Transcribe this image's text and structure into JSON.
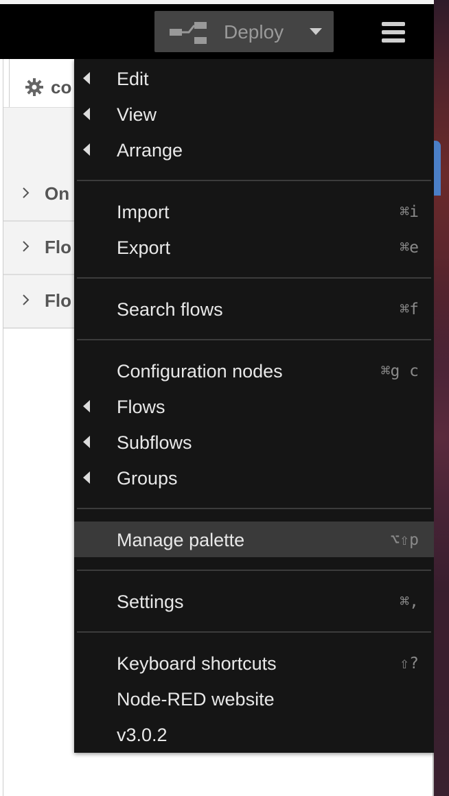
{
  "header": {
    "deploy_label": "Deploy",
    "deploy_icon": "deploy-icon",
    "menu_icon": "hamburger-menu-icon"
  },
  "sidebar": {
    "tab_label": "co",
    "tab_icon": "gear-icon",
    "sections": [
      {
        "label": "On"
      },
      {
        "label": "Flo"
      },
      {
        "label": "Flo"
      }
    ]
  },
  "menu": {
    "items": [
      {
        "label": "Edit",
        "submenu": true,
        "shortcut": ""
      },
      {
        "label": "View",
        "submenu": true,
        "shortcut": ""
      },
      {
        "label": "Arrange",
        "submenu": true,
        "shortcut": ""
      },
      {
        "label": "Import",
        "submenu": false,
        "shortcut": "⌘i"
      },
      {
        "label": "Export",
        "submenu": false,
        "shortcut": "⌘e"
      },
      {
        "label": "Search flows",
        "submenu": false,
        "shortcut": "⌘f"
      },
      {
        "label": "Configuration nodes",
        "submenu": false,
        "shortcut": "⌘g c"
      },
      {
        "label": "Flows",
        "submenu": true,
        "shortcut": ""
      },
      {
        "label": "Subflows",
        "submenu": true,
        "shortcut": ""
      },
      {
        "label": "Groups",
        "submenu": true,
        "shortcut": ""
      },
      {
        "label": "Manage palette",
        "submenu": false,
        "shortcut": "⌥⇧p",
        "highlighted": true
      },
      {
        "label": "Settings",
        "submenu": false,
        "shortcut": "⌘,"
      },
      {
        "label": "Keyboard shortcuts",
        "submenu": false,
        "shortcut": "⇧?"
      },
      {
        "label": "Node-RED website",
        "submenu": false,
        "shortcut": ""
      },
      {
        "label": "v3.0.2",
        "submenu": false,
        "shortcut": ""
      }
    ]
  },
  "colors": {
    "header_bg": "#000000",
    "menu_bg": "#151515",
    "menu_highlight": "#3a3a3a",
    "deploy_bg": "#444444"
  }
}
